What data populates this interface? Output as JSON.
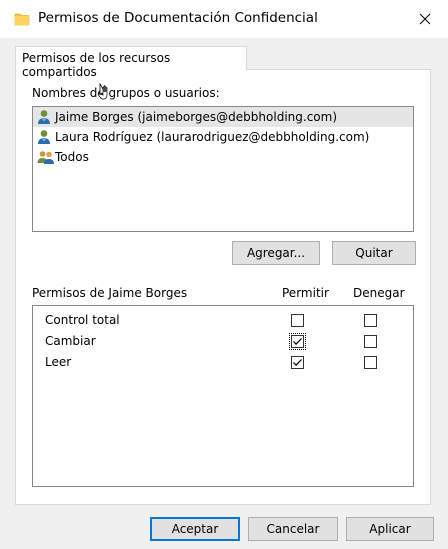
{
  "window": {
    "title": "Permisos de Documentación Confidencial",
    "close_glyph": "✕",
    "folder_icon_color": "#f5c542"
  },
  "tab": {
    "label": "Permisos de los recursos compartidos"
  },
  "groups_section": {
    "label": "Nombres de grupos o usuarios:",
    "items": [
      {
        "label": "Jaime Borges (jaimeborges@debbholding.com)",
        "icon": "user-icon",
        "selected": true
      },
      {
        "label": "Laura Rodríguez (laurarodriguez@debbholding.com)",
        "icon": "user-icon",
        "selected": false
      },
      {
        "label": "Todos",
        "icon": "group-users-icon",
        "selected": false
      }
    ],
    "add_button": "Agregar...",
    "remove_button": "Quitar"
  },
  "permissions": {
    "label": "Permisos de Jaime Borges",
    "allow_header": "Permitir",
    "deny_header": "Denegar",
    "rows": [
      {
        "name": "Control total",
        "allow": false,
        "deny": false
      },
      {
        "name": "Cambiar",
        "allow": true,
        "deny": false
      },
      {
        "name": "Leer",
        "allow": true,
        "deny": false
      }
    ]
  },
  "footer": {
    "ok_button": "Aceptar",
    "cancel_button": "Cancelar",
    "apply_button": "Aplicar"
  },
  "colors": {
    "accent": "#0078d7",
    "selection": "#e5e5e5"
  }
}
